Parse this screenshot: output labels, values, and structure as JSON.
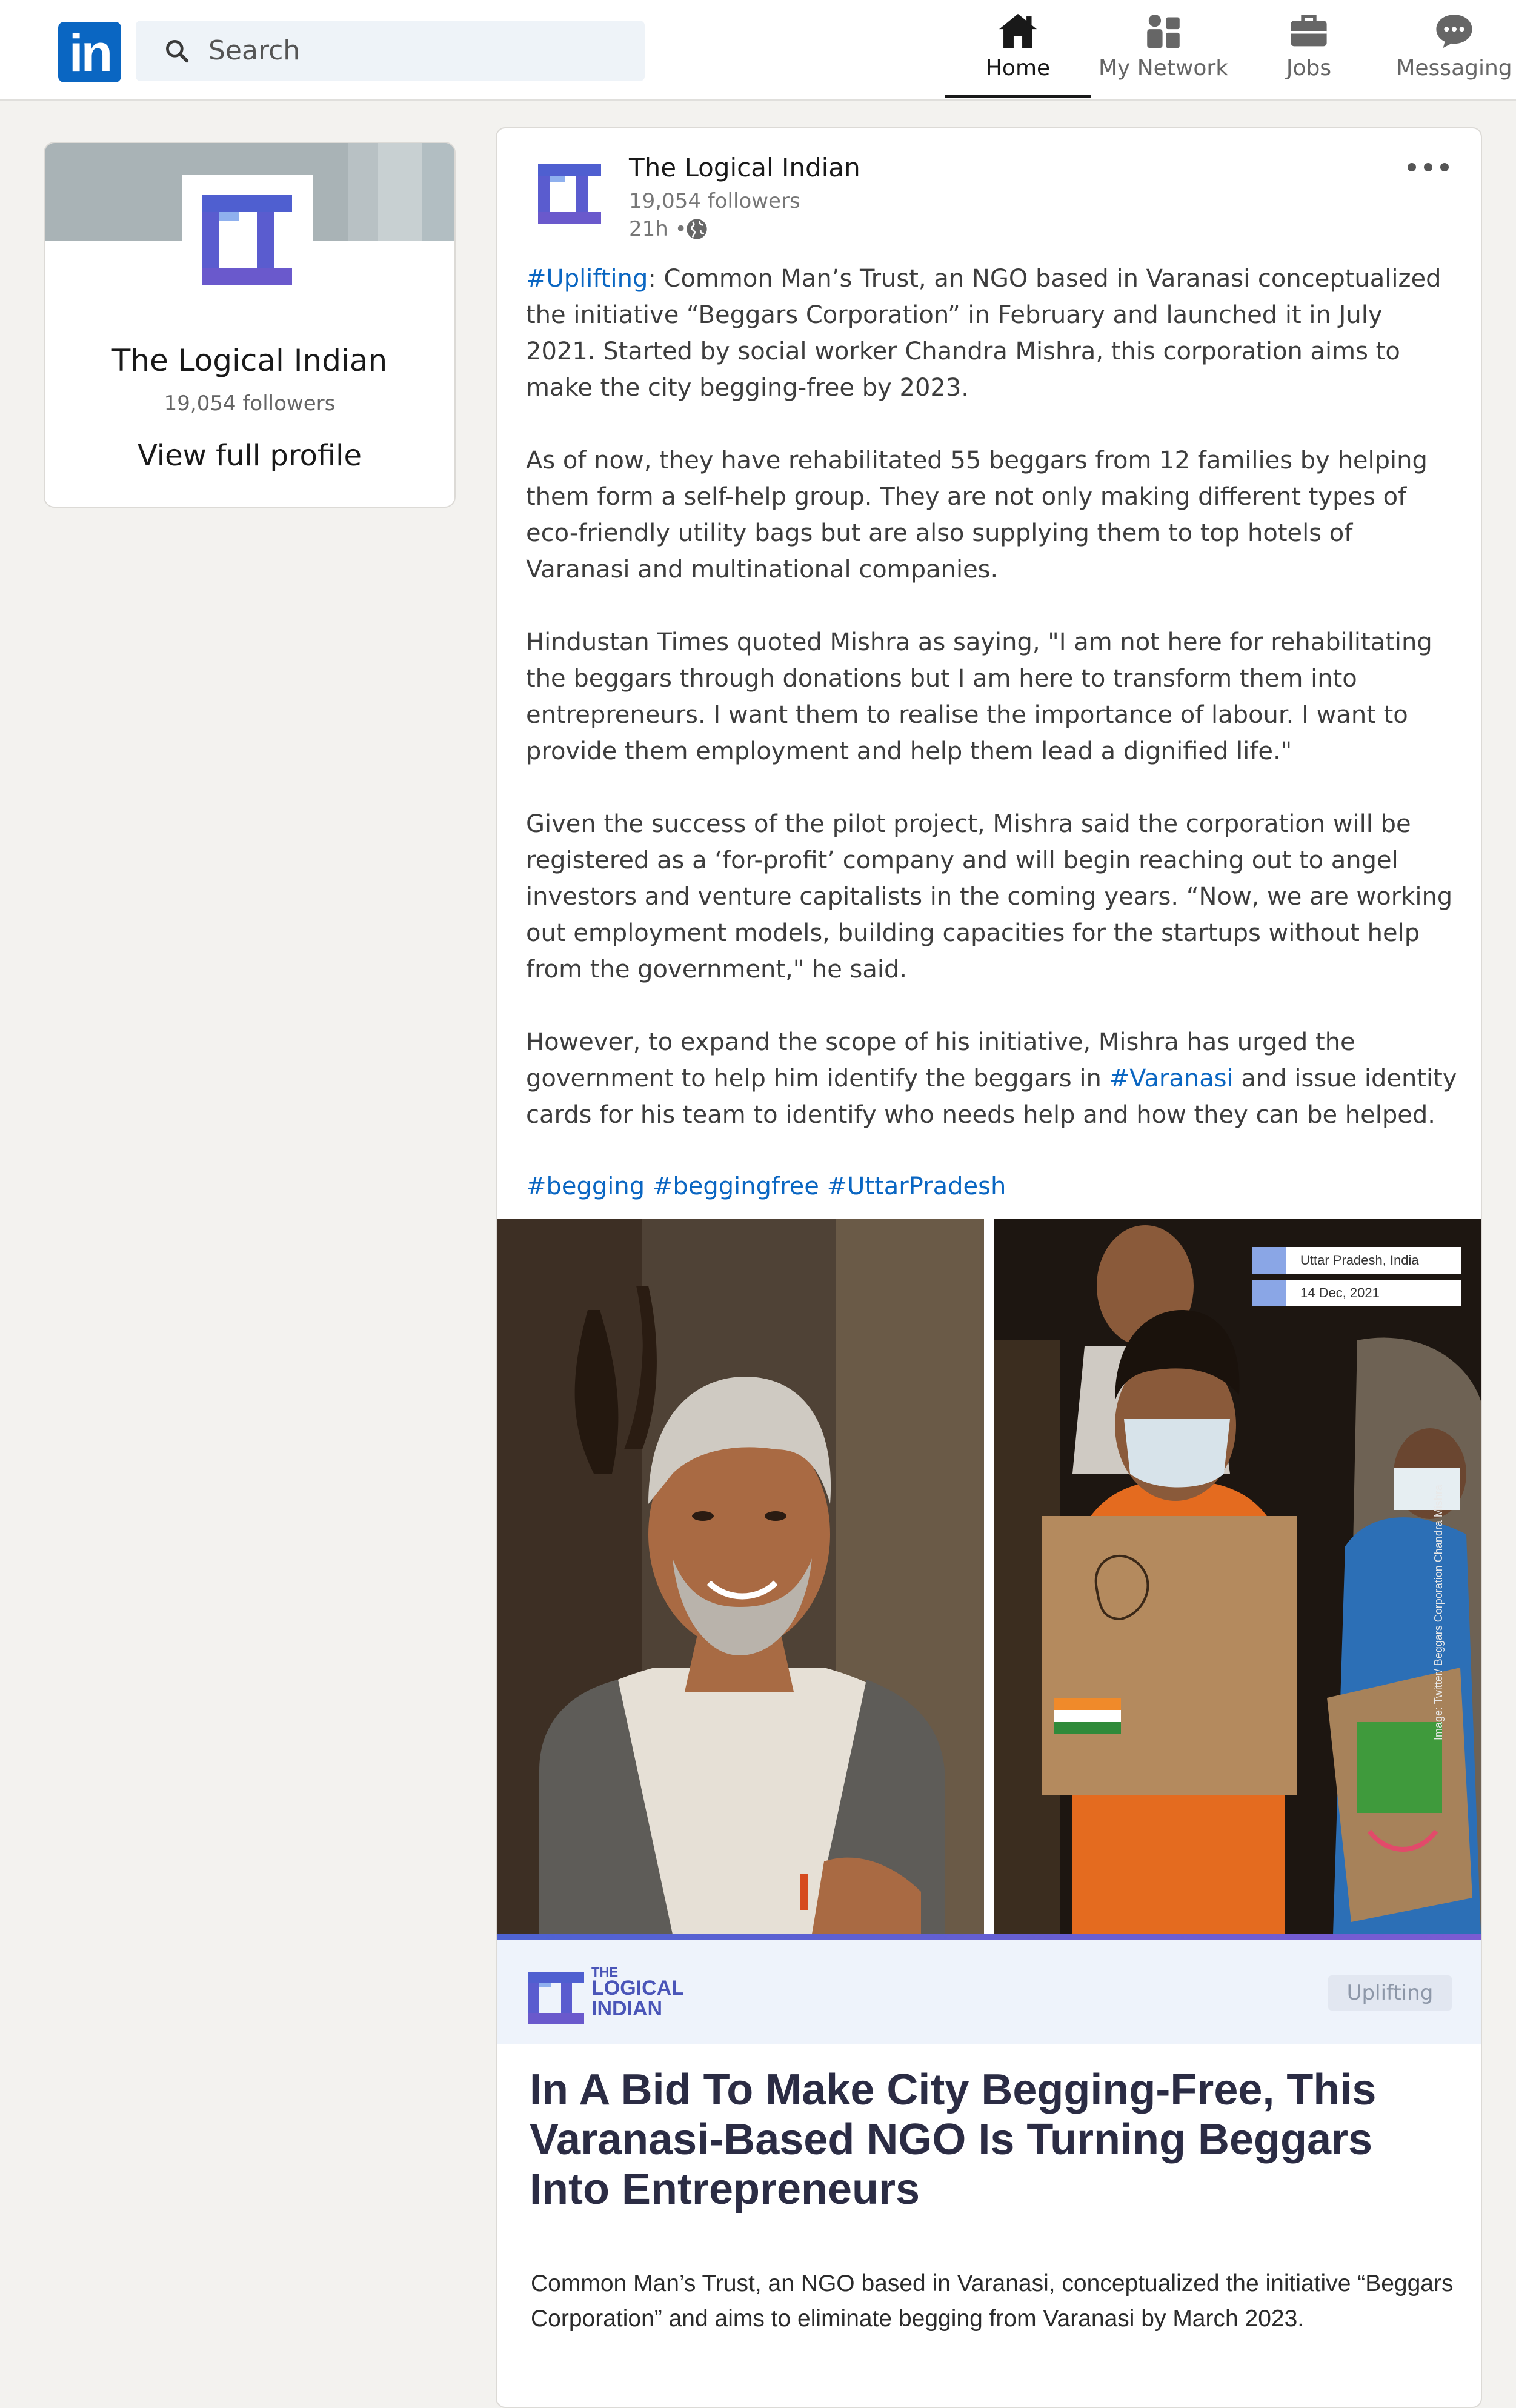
{
  "nav": {
    "logo": "in",
    "search_label": "Search",
    "items": [
      {
        "label": "Home",
        "icon": "home-icon",
        "active": true
      },
      {
        "label": "My Network",
        "icon": "network-icon",
        "active": false
      },
      {
        "label": "Jobs",
        "icon": "briefcase-icon",
        "active": false
      },
      {
        "label": "Messaging",
        "icon": "messaging-icon",
        "active": false
      }
    ]
  },
  "profile": {
    "name": "The Logical Indian",
    "followers": "19,054 followers",
    "view_profile_label": "View full profile"
  },
  "post": {
    "author": "The Logical Indian",
    "followers": "19,054 followers",
    "time": "21h •",
    "paragraphs": {
      "p1_tag": "#Uplifting",
      "p1_text": ": Common Man’s Trust, an NGO based in Varanasi conceptualized the initiative “Beggars Corporation” in February and launched it in July 2021. Started by social worker Chandra Mishra, this corporation aims to make the city begging-free by 2023.",
      "p2": "As of now, they have rehabilitated 55 beggars from 12 families by helping them form a self-help group. They are not only making different types of eco-friendly utility bags but are also supplying them to top hotels of Varanasi and multinational companies.",
      "p3": "Hindustan Times quoted Mishra as saying, \"I am not here for rehabilitating the beggars through donations but I am here to transform them into entrepreneurs. I want them to realise the importance of labour. I want to provide them employment and help them lead a dignified life.\"",
      "p4": "Given the success of the pilot project, Mishra said the corporation will be registered as a ‘for-profit’ company and will begin reaching out to angel investors and venture capitalists in the coming years. “Now, we are working out employment models, building capacities for the startups without help from the government,\" he said.",
      "p5_before": "However, to expand the scope of his initiative, Mishra has urged the government to help him identify the beggars in ",
      "p5_tag": "#Varanasi",
      "p5_after": " and issue identity cards for his team to identify who needs help and how they can be helped."
    },
    "hashtags": [
      "#begging",
      "#beggingfree",
      "#UttarPradesh"
    ]
  },
  "image": {
    "location": "Uttar Pradesh, India",
    "date": "14 Dec, 2021",
    "credit": "Image: Twitter/ Beggars Corporation Chandra Mishra"
  },
  "preview": {
    "brand_the": "THE",
    "brand_line1": "LOGICAL",
    "brand_line2": "INDIAN",
    "category": "Uplifting",
    "title": "In A Bid To Make City Begging-Free, This Varanasi-Based NGO Is Turning Beggars Into Entrepreneurs",
    "description": "Common Man’s Trust, an NGO based in Varanasi, conceptualized the initiative “Beggars Corporation” and aims to eliminate begging from Varanasi by March 2023."
  },
  "colors": {
    "linkedin_blue": "#0a66c2",
    "brand_indigo": "#4a55b8",
    "page_bg": "#f3f2ef"
  }
}
